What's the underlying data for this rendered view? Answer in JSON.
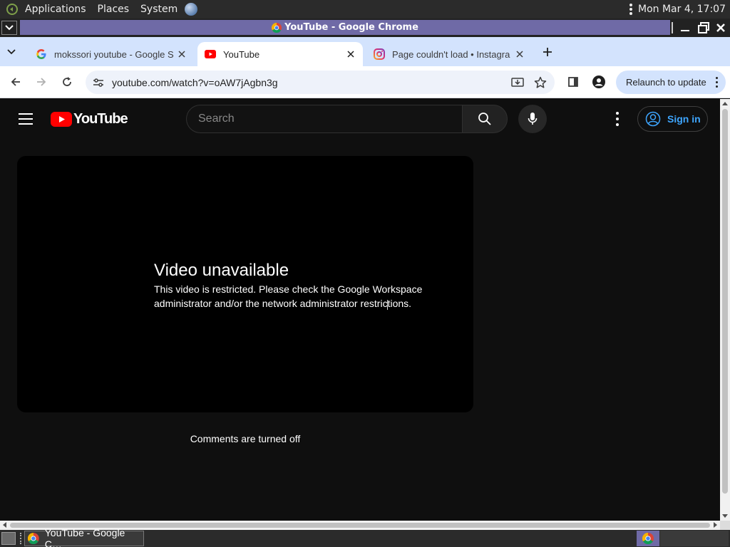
{
  "desktop_panel": {
    "menus": [
      "Applications",
      "Places",
      "System"
    ],
    "clock": "Mon Mar  4, 17:07"
  },
  "window": {
    "title": "YouTube - Google Chrome"
  },
  "tabs": [
    {
      "label": "mokssori youtube - Google S",
      "icon": "google-g-icon",
      "active": false
    },
    {
      "label": "YouTube",
      "icon": "youtube-icon",
      "active": true
    },
    {
      "label": "Page couldn't load • Instagra",
      "icon": "instagram-icon",
      "active": false
    }
  ],
  "toolbar": {
    "url": "youtube.com/watch?v=oAW7jAgbn3g",
    "relaunch_label": "Relaunch to update"
  },
  "youtube": {
    "logo_text": "YouTube",
    "search_placeholder": "Search",
    "signin_label": "Sign in",
    "player": {
      "heading": "Video unavailable",
      "message": "This video is restricted. Please check the Google Workspace administrator and/or the network administrator restrictions."
    },
    "comments_status": "Comments are turned off"
  },
  "taskbar": {
    "task_label": "YouTube - Google C…"
  },
  "colors": {
    "yt_red": "#ff0000",
    "yt_background": "#0f0f0f",
    "signin_blue": "#3ea6ff",
    "chrome_tabstrip": "#d3e3fd",
    "titlebar_accent": "#6f6aa6"
  }
}
